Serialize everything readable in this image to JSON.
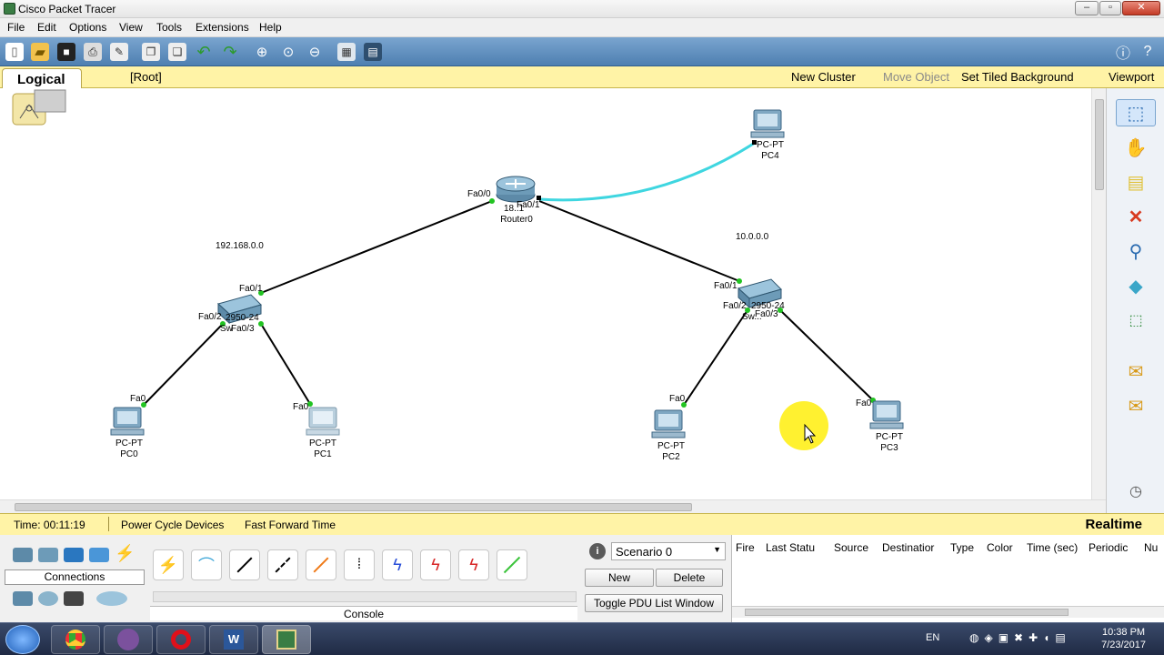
{
  "window": {
    "title": "Cisco Packet Tracer"
  },
  "menu": [
    "File",
    "Edit",
    "Options",
    "View",
    "Tools",
    "Extensions",
    "Help"
  ],
  "workspace_bar": {
    "tab": "Logical",
    "root": "[Root]",
    "new_cluster": "New Cluster",
    "move_object": "Move Object",
    "set_tiled_background": "Set Tiled Background",
    "viewport": "Viewport"
  },
  "network": {
    "subnet_left": "192.168.0.0",
    "subnet_right": "10.0.0.0",
    "router": {
      "model": "18..1",
      "name": "Router0",
      "port_left": "Fa0/0",
      "port_right": "Fa0/1"
    },
    "switch_left": {
      "model": "2950-24",
      "name": "Sw",
      "port_up": "Fa0/1",
      "port_left": "Fa0/2",
      "port_right": "Fa0/3"
    },
    "switch_right": {
      "model": "2950-24",
      "name": "Sw...",
      "port_up": "Fa0/1",
      "port_left": "Fa0/2",
      "port_right": "Fa0/3"
    },
    "pcs": [
      {
        "type": "PC-PT",
        "name": "PC0",
        "port": "Fa0"
      },
      {
        "type": "PC-PT",
        "name": "PC1",
        "port": "Fa0"
      },
      {
        "type": "PC-PT",
        "name": "PC2",
        "port": "Fa0"
      },
      {
        "type": "PC-PT",
        "name": "PC3",
        "port": "Fa0"
      },
      {
        "type": "PC-PT",
        "name": "PC4",
        "port": ""
      }
    ],
    "link_color_crossover": "#3fd6e0",
    "link_color_straight": "#000000",
    "port_up_color": "#22c422"
  },
  "status": {
    "time": "Time: 00:11:19",
    "power_cycle": "Power Cycle Devices",
    "fast_forward": "Fast Forward Time",
    "mode": "Realtime"
  },
  "bottom": {
    "category_label": "Connections",
    "console_label": "Console",
    "scenario": "Scenario 0",
    "new_btn": "New",
    "delete_btn": "Delete",
    "toggle_btn": "Toggle PDU List Window",
    "pdu_columns": [
      "Fire",
      "Last Statu",
      "Source",
      "Destinatior",
      "Type",
      "Color",
      "Time (sec)",
      "Periodic",
      "Nu"
    ]
  },
  "taskbar": {
    "lang": "EN",
    "time": "10:38 PM",
    "date": "7/23/2017"
  }
}
